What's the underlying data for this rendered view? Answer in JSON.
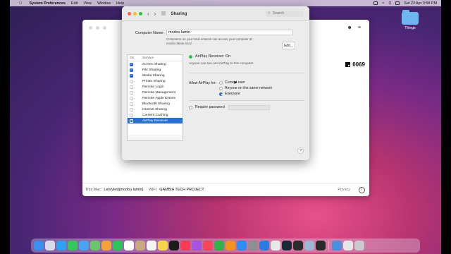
{
  "menubar": {
    "app_name": "System Preferences",
    "items": [
      "Edit",
      "View",
      "Window",
      "Help"
    ],
    "datetime": "Sat 23 Apr  3:58 PM"
  },
  "desktop": {
    "folder_label": "Things"
  },
  "browser": {
    "code": "0069",
    "footer": {
      "mac_label": "This Mac:",
      "mac_value": "LetsView[modou lamin]",
      "wifi_label": "WiFi:",
      "wifi_value": "GAMBIA TECH PROJECT",
      "privacy": "Privacy",
      "info_glyph": "!"
    }
  },
  "prefs": {
    "title": "Sharing",
    "search_placeholder": "Search",
    "computer_name_label": "Computer Name:",
    "computer_name_value": "modou lamin",
    "computer_name_desc_1": "Computers on your local network can access your computer at:",
    "computer_name_desc_2": "modou-lamin.local",
    "edit_button": "Edit...",
    "list_header_on": "On",
    "list_header_service": "Service",
    "services": [
      {
        "name": "Screen Sharing",
        "on": true
      },
      {
        "name": "File Sharing",
        "on": true
      },
      {
        "name": "Media Sharing",
        "on": true
      },
      {
        "name": "Printer Sharing",
        "on": false
      },
      {
        "name": "Remote Login",
        "on": false
      },
      {
        "name": "Remote Management",
        "on": false
      },
      {
        "name": "Remote Apple Events",
        "on": false
      },
      {
        "name": "Bluetooth Sharing",
        "on": false
      },
      {
        "name": "Internet Sharing",
        "on": false
      },
      {
        "name": "Content Caching",
        "on": false
      },
      {
        "name": "AirPlay Receiver",
        "on": true,
        "selected": true
      }
    ],
    "status_text": "AirPlay Receiver: On",
    "status_desc": "Anyone can see and AirPlay to this computer.",
    "allow_label": "Allow AirPlay for:",
    "options": [
      "Current user",
      "Anyone on the same network",
      "Everyone"
    ],
    "selected_option": 2,
    "require_password": "Require password",
    "help": "?"
  },
  "dock": {
    "icons": [
      {
        "name": "finder-icon",
        "color": "#3b8ff0"
      },
      {
        "name": "launchpad-icon",
        "color": "#d9d9e8"
      },
      {
        "name": "safari-icon",
        "color": "#2ea1f2"
      },
      {
        "name": "messages-icon",
        "color": "#34c759"
      },
      {
        "name": "mail-icon",
        "color": "#4aa3f2"
      },
      {
        "name": "maps-icon",
        "color": "#6cc46a"
      },
      {
        "name": "photos-icon",
        "color": "#f2a33a"
      },
      {
        "name": "facetime-icon",
        "color": "#2fc25b"
      },
      {
        "name": "calendar-icon",
        "color": "#ffffff"
      },
      {
        "name": "contacts-icon",
        "color": "#c9a982"
      },
      {
        "name": "reminders-icon",
        "color": "#f4f4f4"
      },
      {
        "name": "notes-icon",
        "color": "#f7d54a"
      },
      {
        "name": "tv-icon",
        "color": "#1c1c1e"
      },
      {
        "name": "music-icon",
        "color": "#fa3c54"
      },
      {
        "name": "podcasts-icon",
        "color": "#a555e0"
      },
      {
        "name": "news-icon",
        "color": "#f3485b"
      },
      {
        "name": "numbers-icon",
        "color": "#33b24a"
      },
      {
        "name": "pages-icon",
        "color": "#f2941f"
      },
      {
        "name": "app-store-icon",
        "color": "#2c8ef2"
      },
      {
        "name": "system-preferences-icon",
        "color": "#8e8e93"
      },
      {
        "name": "xcode-icon",
        "color": "#2a7be4"
      },
      {
        "name": "chrome-icon",
        "color": "#e8e8e8"
      },
      {
        "name": "steam-icon",
        "color": "#1b2838"
      },
      {
        "name": "obs-icon",
        "color": "#2b2b2b"
      },
      {
        "name": "preview-icon",
        "color": "#9bb7d4"
      },
      {
        "name": "terminal-icon",
        "color": "#2a2a2a"
      },
      {
        "name": "downloads-icon",
        "color": "#4a90e2"
      },
      {
        "name": "document-icon",
        "color": "#e6e6e6"
      },
      {
        "name": "trash-icon",
        "color": "#c9c9cf"
      }
    ]
  }
}
